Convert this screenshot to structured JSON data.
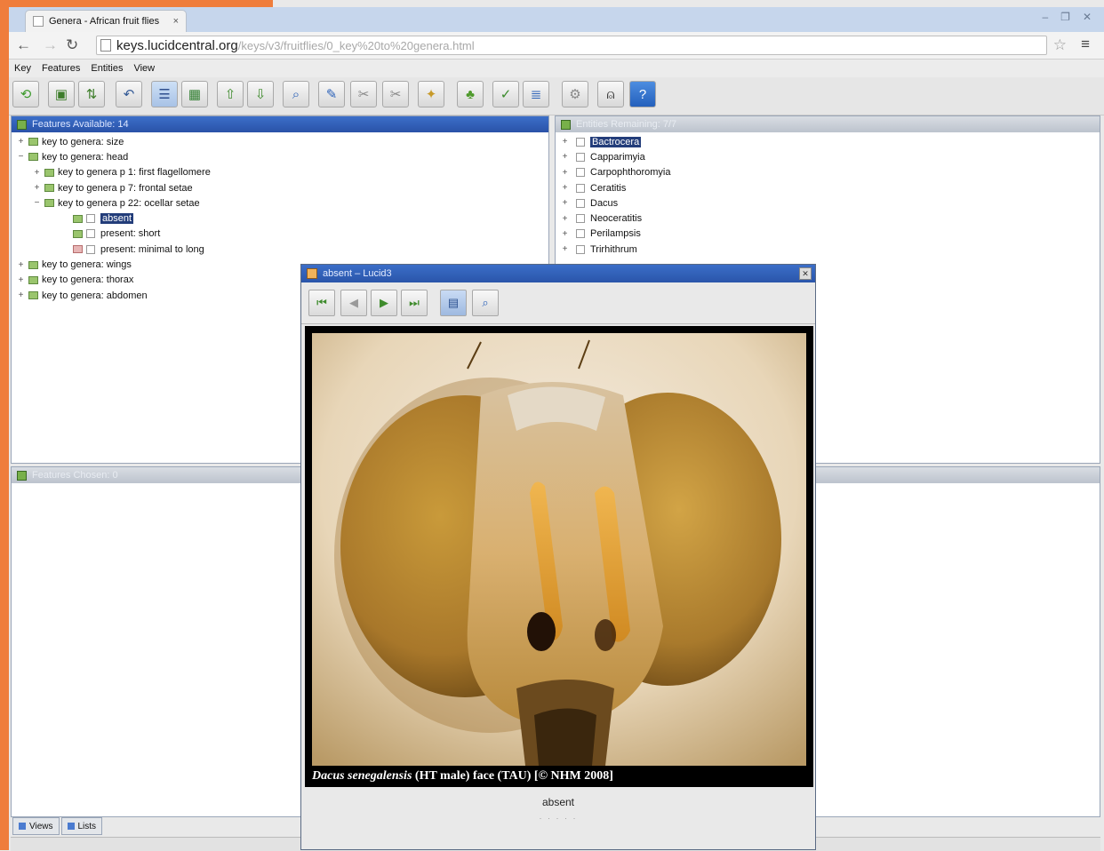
{
  "browser": {
    "tab_title": "Genera - African fruit flies",
    "tab_close": "×",
    "url_host": "keys.lucidcentral.org",
    "url_path": "/keys/v3/fruitflies/0_key%20to%20genera.html",
    "window_controls": [
      "–",
      "❐",
      "✕"
    ]
  },
  "app_menu": [
    "Key",
    "Features",
    "Entities",
    "View"
  ],
  "panels": {
    "features_available": {
      "title": "Features Available: 14",
      "tree": [
        {
          "level": 0,
          "expander": "+",
          "label": "key to genera: size",
          "kind": "group"
        },
        {
          "level": 0,
          "expander": "−",
          "label": "key to genera: head",
          "kind": "group"
        },
        {
          "level": 1,
          "expander": "+",
          "label": "key to genera p 1: first flagellomere",
          "kind": "group"
        },
        {
          "level": 1,
          "expander": "+",
          "label": "key to genera p 7: frontal setae",
          "kind": "group"
        },
        {
          "level": 1,
          "expander": "−",
          "label": "key to genera p 22: ocellar setae",
          "kind": "group"
        },
        {
          "level": 2,
          "expander": "",
          "label": "absent",
          "kind": "state",
          "selected": true
        },
        {
          "level": 2,
          "expander": "",
          "label": "present: short",
          "kind": "state"
        },
        {
          "level": 2,
          "expander": "",
          "label": "present: minimal to long",
          "kind": "state"
        },
        {
          "level": 0,
          "expander": "+",
          "label": "key to genera: wings",
          "kind": "group"
        },
        {
          "level": 0,
          "expander": "+",
          "label": "key to genera: thorax",
          "kind": "group"
        },
        {
          "level": 0,
          "expander": "+",
          "label": "key to genera: abdomen",
          "kind": "group"
        }
      ]
    },
    "entities_remaining": {
      "title": "Entities Remaining: 7/7",
      "tree": [
        {
          "expander": "+",
          "label": "Bactrocera",
          "selected": true
        },
        {
          "expander": "+",
          "label": "Capparimyia"
        },
        {
          "expander": "+",
          "label": "Carpophthoromyia"
        },
        {
          "expander": "+",
          "label": "Ceratitis"
        },
        {
          "expander": "+",
          "label": "Dacus"
        },
        {
          "expander": "+",
          "label": "Neoceratitis"
        },
        {
          "expander": "+",
          "label": "Perilampsis"
        },
        {
          "expander": "+",
          "label": "Trirhithrum"
        }
      ]
    },
    "features_chosen": {
      "title": "Features Chosen: 0"
    },
    "bottom_tabs": [
      "Views",
      "Lists"
    ]
  },
  "dialog": {
    "title": "absent – Lucid3",
    "close": "✕",
    "caption_italic": "Dacus senegalensis",
    "caption_rest": " (HT male) face (TAU) [© NHM 2008]",
    "state_label": "absent",
    "footer": "· · · · ·"
  },
  "toolbar_icons": [
    "restart-icon",
    "open-key-icon",
    "refresh-icon",
    "back-icon",
    "list-view-icon",
    "grid-view-icon",
    "promote-icon",
    "demote-icon",
    "find-icon",
    "wand-icon",
    "prune-icon",
    "prune2-icon",
    "bug-icon",
    "entities-icon",
    "best-icon",
    "list2-icon",
    "settings-icon",
    "bell-icon",
    "help-icon"
  ]
}
